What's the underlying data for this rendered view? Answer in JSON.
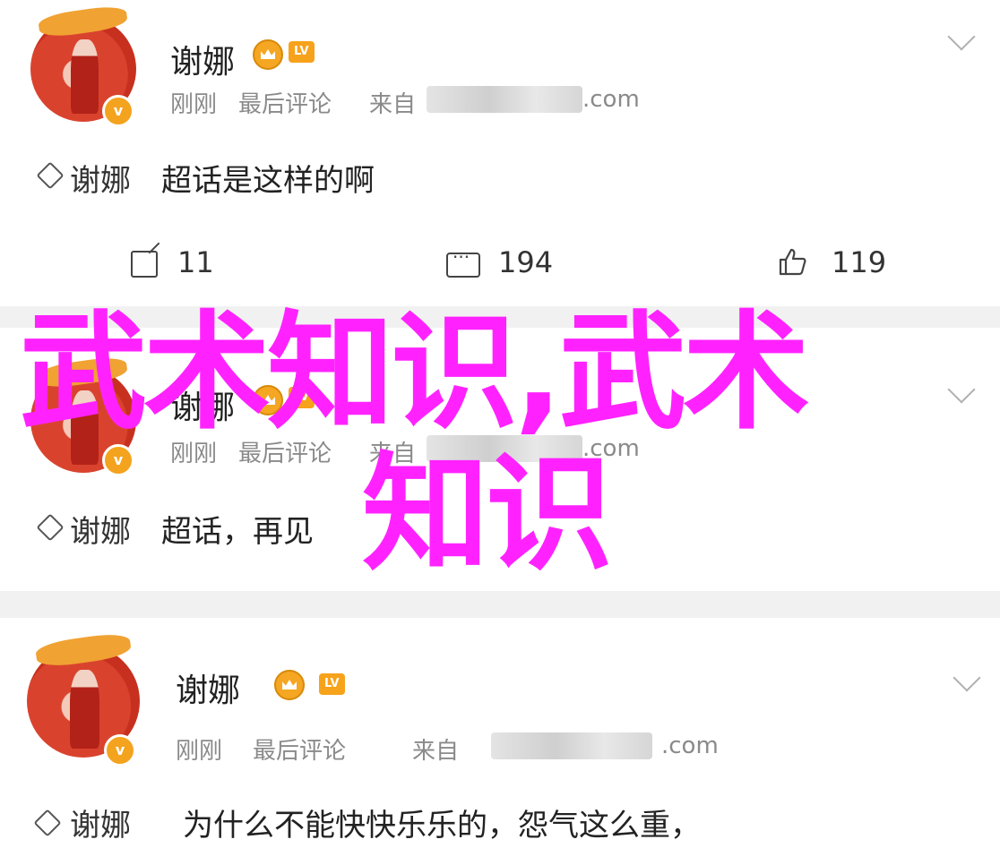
{
  "posts": [
    {
      "username": "谢娜",
      "level_badge": "LV",
      "meta_time": "刚刚",
      "meta_action": "最后评论",
      "meta_from": "来自",
      "meta_source_suffix": ".com",
      "comment_prefix": "谢娜",
      "comment_text": "超话是这样的啊",
      "shares": "11",
      "comments": "194",
      "likes": "119"
    },
    {
      "username": "谢娜",
      "level_badge": "LV",
      "meta_time": "刚刚",
      "meta_action": "最后评论",
      "meta_from": "来自",
      "meta_source_suffix": ".com",
      "comment_prefix": "谢娜",
      "comment_text": "超话，再见"
    },
    {
      "username": "谢娜",
      "level_badge": "LV",
      "meta_time": "刚刚",
      "meta_action": "最后评论",
      "meta_from": "来自",
      "meta_source_suffix": ".com",
      "comment_prefix": "谢娜",
      "comment_text": "为什么不能快快乐乐的，怨气这么重，"
    }
  ],
  "overlay": {
    "line1": "武术知识,武术",
    "line2": "知识",
    "color": "#ff22ff"
  },
  "icons": {
    "verified": "v",
    "crown": "crown-icon",
    "share": "share-icon",
    "comment": "comment-icon",
    "like": "thumbs-up-icon",
    "super_topic": "diamond-icon",
    "expand": "chevron-down-icon"
  }
}
